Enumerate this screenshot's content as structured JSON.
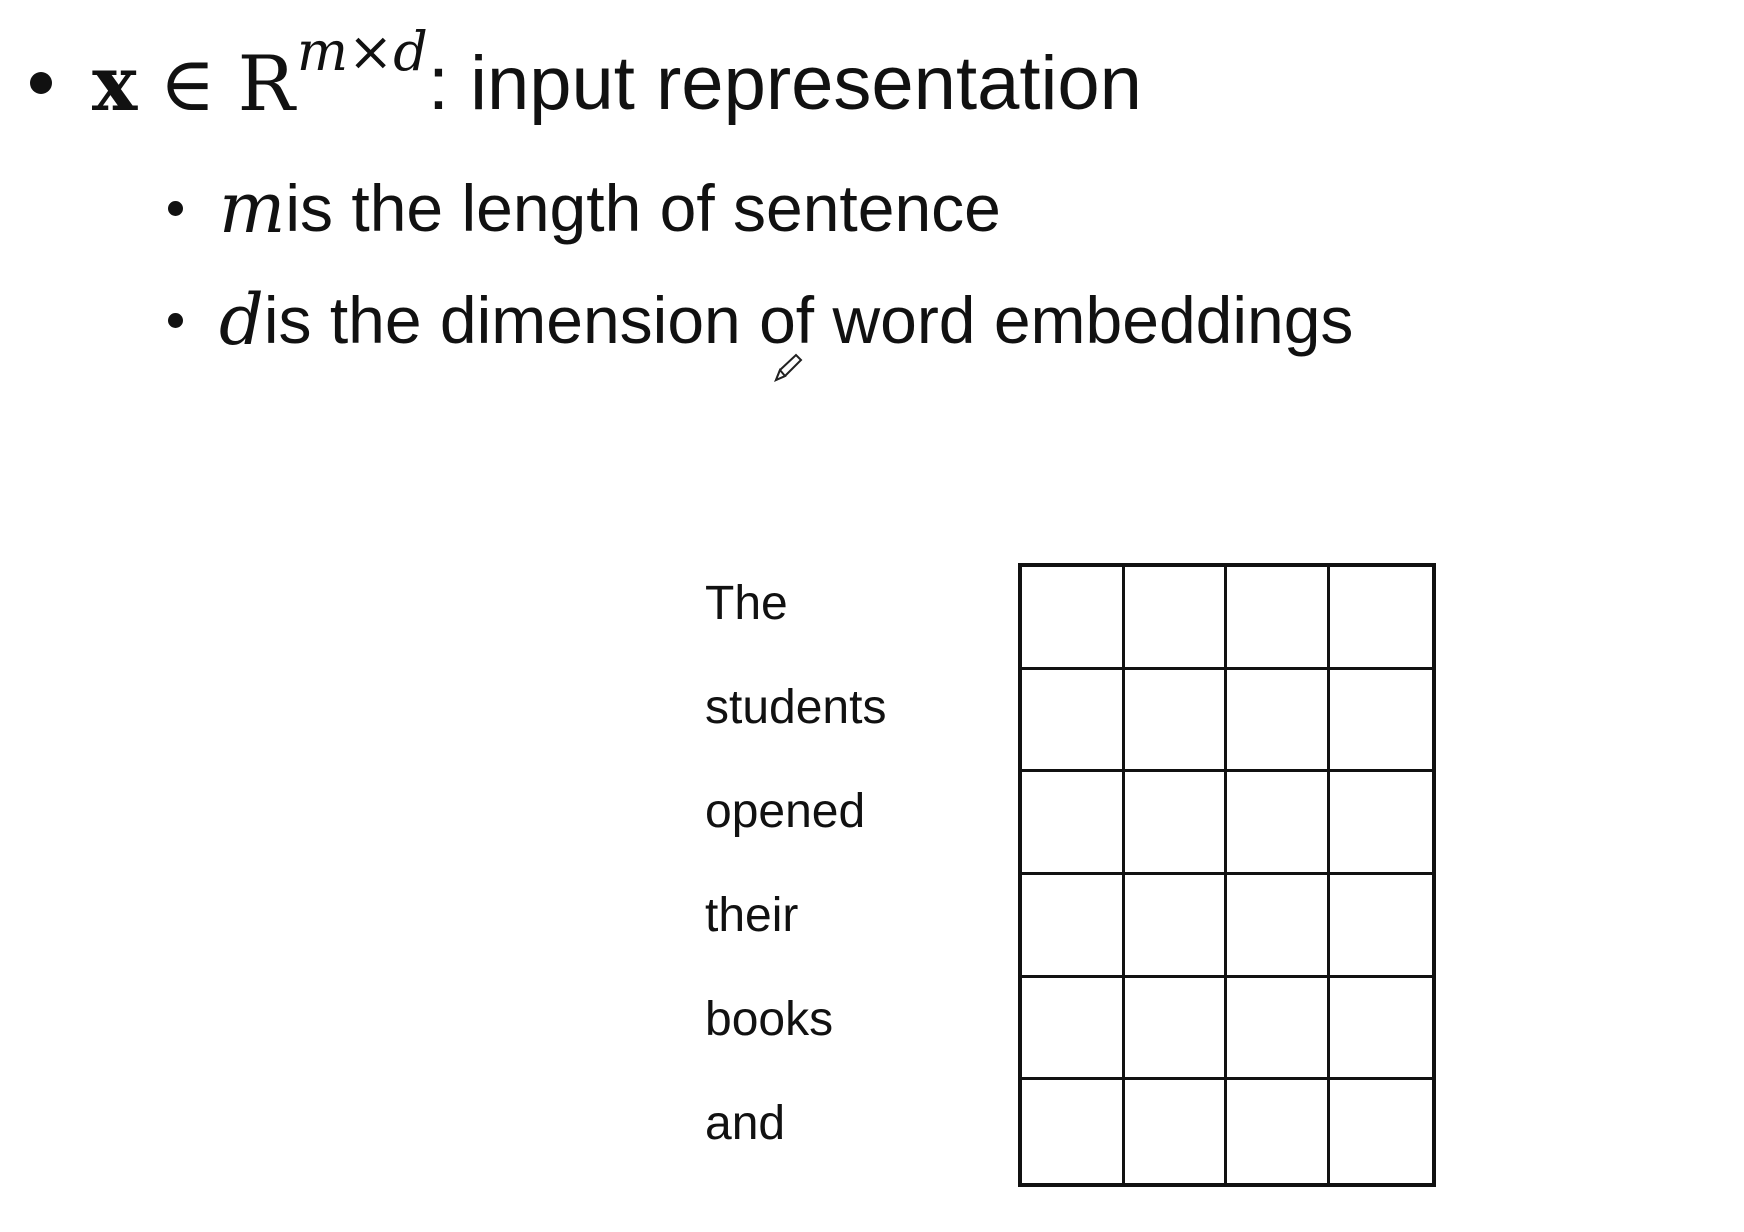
{
  "bullets": {
    "main": {
      "var": "x",
      "elem": "∈",
      "set": "R",
      "sup": "m×d",
      "text": ": input representation"
    },
    "sub": [
      {
        "var": "m",
        "text": " is the length of sentence"
      },
      {
        "var": "d",
        "text": " is the dimension of word embeddings"
      }
    ]
  },
  "diagram": {
    "words": [
      "The",
      "students",
      "opened",
      "their",
      "books",
      "and"
    ],
    "rows": 6,
    "cols": 4
  },
  "icons": {
    "cursor": "pen-cursor-icon"
  }
}
